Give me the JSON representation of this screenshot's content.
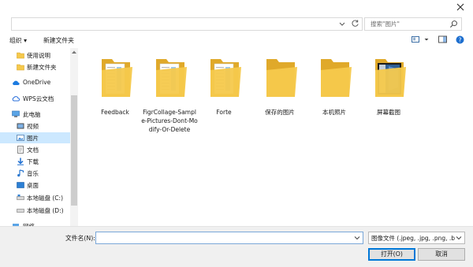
{
  "window": {
    "close_label": "×"
  },
  "address_bar": {
    "value": ""
  },
  "search": {
    "placeholder": "搜索\"图片\""
  },
  "toolbar": {
    "organize_label": "组织 ▾",
    "new_folder_label": "新建文件夹"
  },
  "nav": {
    "items": [
      {
        "label": "使用说明",
        "icon": "folder-icon"
      },
      {
        "label": "新建文件夹",
        "icon": "folder-icon"
      },
      {
        "label": "OneDrive",
        "icon": "cloud-icon"
      },
      {
        "label": "WPS云文档",
        "icon": "wps-cloud-icon"
      },
      {
        "label": "此电脑",
        "icon": "pc-icon"
      },
      {
        "label": "视频",
        "icon": "video-folder-icon"
      },
      {
        "label": "图片",
        "icon": "pictures-folder-icon",
        "selected": true
      },
      {
        "label": "文档",
        "icon": "documents-folder-icon"
      },
      {
        "label": "下载",
        "icon": "download-icon"
      },
      {
        "label": "音乐",
        "icon": "music-icon"
      },
      {
        "label": "桌面",
        "icon": "desktop-icon"
      },
      {
        "label": "本地磁盘 (C:)",
        "icon": "drive-icon"
      },
      {
        "label": "本地磁盘 (D:)",
        "icon": "drive-icon"
      },
      {
        "label": "网络",
        "icon": "network-icon"
      }
    ]
  },
  "folders": [
    {
      "name": "Feedback",
      "preview": "docs"
    },
    {
      "name": "FigrCollage-Sample-Pictures-Dont-Modify-Or-Delete",
      "preview": "docs"
    },
    {
      "name": "Forte",
      "preview": "docs"
    },
    {
      "name": "保存的图片",
      "preview": "empty"
    },
    {
      "name": "本机照片",
      "preview": "empty"
    },
    {
      "name": "屏幕截图",
      "preview": "image"
    }
  ],
  "bottom": {
    "filename_label": "文件名(N):",
    "filename_value": "",
    "filetype_value": "图像文件 (.jpeg, .jpg, .png, .b",
    "open_label": "打开(O)",
    "cancel_label": "取消"
  },
  "colors": {
    "folder": "#f5c94c",
    "folder_dark": "#e0a92a",
    "selection": "#cce8ff",
    "accent": "#0078d7"
  }
}
